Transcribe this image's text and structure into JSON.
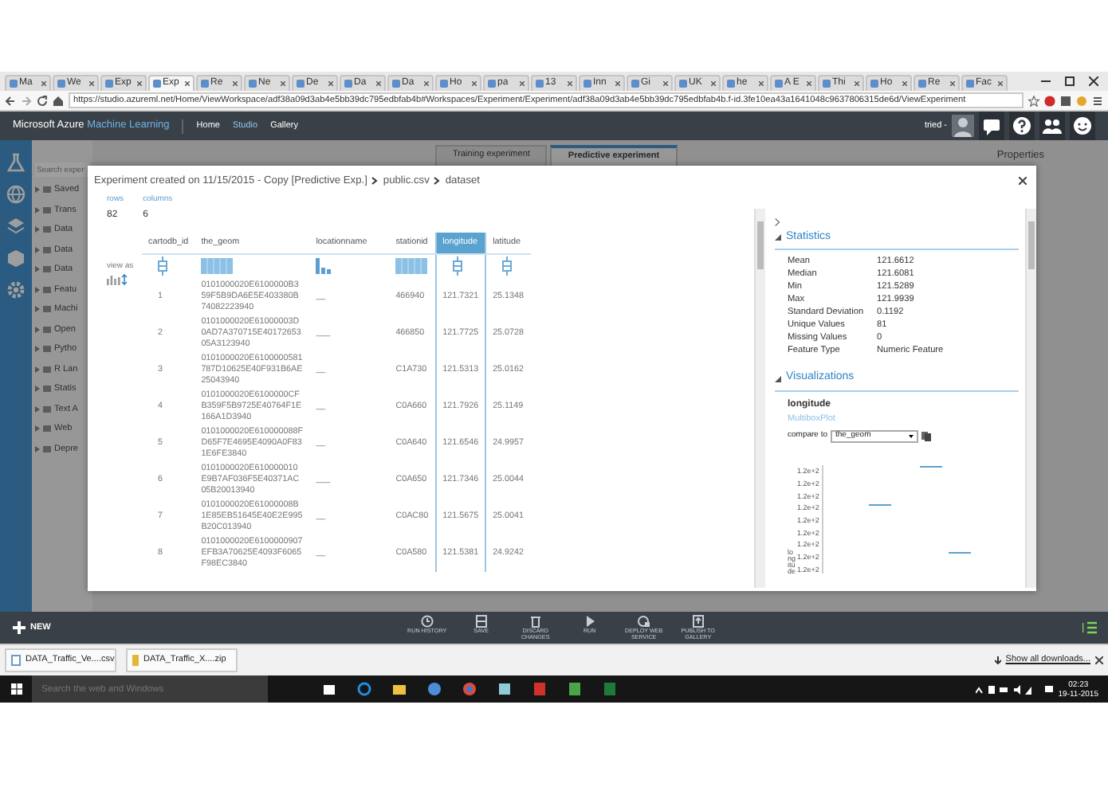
{
  "browser": {
    "tabs": [
      {
        "label": "Ma",
        "selected": false
      },
      {
        "label": "We",
        "selected": false
      },
      {
        "label": "Exp",
        "selected": false
      },
      {
        "label": "Exp",
        "selected": true
      },
      {
        "label": "Re",
        "selected": false
      },
      {
        "label": "Ne",
        "selected": false
      },
      {
        "label": "De",
        "selected": false
      },
      {
        "label": "Da",
        "selected": false
      },
      {
        "label": "Da",
        "selected": false
      },
      {
        "label": "Ho",
        "selected": false
      },
      {
        "label": "pa",
        "selected": false
      },
      {
        "label": "13",
        "selected": false
      },
      {
        "label": "Inn",
        "selected": false
      },
      {
        "label": "Gi",
        "selected": false
      },
      {
        "label": "UK",
        "selected": false
      },
      {
        "label": "he",
        "selected": false
      },
      {
        "label": "A E",
        "selected": false
      },
      {
        "label": "Thi",
        "selected": false
      },
      {
        "label": "Ho",
        "selected": false
      },
      {
        "label": "Re",
        "selected": false
      },
      {
        "label": "Fac",
        "selected": false
      }
    ],
    "url": "https://studio.azureml.net/Home/ViewWorkspace/adf38a09d3ab4e5bb39dc795edbfab4b#Workspaces/Experiment/Experiment/adf38a09d3ab4e5bb39dc795edbfab4b.f-id.3fe10ea43a1641048c9637806315de6d/ViewExperiment"
  },
  "app_header": {
    "brand": "Microsoft Azure",
    "product": "Machine Learning",
    "nav": [
      {
        "label": "Home",
        "selected": false
      },
      {
        "label": "Studio",
        "selected": true
      },
      {
        "label": "Gallery",
        "selected": false
      }
    ],
    "user": "tried -"
  },
  "workspace": {
    "experiment_tabs": [
      {
        "label": "Training experiment",
        "selected": false
      },
      {
        "label": "Predictive experiment",
        "selected": true
      }
    ],
    "search": {
      "placeholder": "Search exper"
    },
    "palette": [
      "Saved",
      "Trans",
      "Data",
      "Data",
      "Data",
      "Featu",
      "Machi",
      "Open",
      "Pytho",
      "R Lan",
      "Statis",
      "Text A",
      "Web",
      "Depre"
    ],
    "properties_title": "Properties"
  },
  "dialog": {
    "breadcrumb": [
      "Experiment created on 11/15/2015 - Copy [Predictive Exp.]",
      "public.csv",
      "dataset"
    ],
    "summary": [
      {
        "label": "rows",
        "value": "82"
      },
      {
        "label": "columns",
        "value": "6"
      }
    ],
    "view_as": "view as",
    "columns": [
      {
        "name": "cartodb_id",
        "kind": "numeric",
        "selected": false
      },
      {
        "name": "the_geom",
        "kind": "text",
        "selected": false
      },
      {
        "name": "locationname",
        "kind": "category",
        "selected": false
      },
      {
        "name": "stationid",
        "kind": "text",
        "selected": false
      },
      {
        "name": "longitude",
        "kind": "numeric",
        "selected": true
      },
      {
        "name": "latitude",
        "kind": "numeric",
        "selected": false
      }
    ],
    "rows": [
      [
        "1",
        "0101000020E6100000B359F5B9DA6E5E403380B74082223940",
        "__",
        "466940",
        "121.7321",
        "25.1348"
      ],
      [
        "2",
        "0101000020E61000003D0AD7A370715E4017265305A3123940",
        "___",
        "466850",
        "121.7725",
        "25.0728"
      ],
      [
        "3",
        "0101000020E6100000581787D10625E40F931B6AE25043940",
        "__",
        "C1A730",
        "121.5313",
        "25.0162"
      ],
      [
        "4",
        "0101000020E6100000CFB359F5B9725E40764F1E166A1D3940",
        "__",
        "C0A660",
        "121.7926",
        "25.1149"
      ],
      [
        "5",
        "0101000020E610000088FD65F7E4695E4090A0F831E6FE3840",
        "__",
        "C0A640",
        "121.6546",
        "24.9957"
      ],
      [
        "6",
        "0101000020E610000010E9B7AF036F5E40371AC05B20013940",
        "___",
        "C0A650",
        "121.7346",
        "25.0044"
      ],
      [
        "7",
        "0101000020E61000008B1E85EB51645E40E2E995B20C013940",
        "__",
        "C0AC80",
        "121.5675",
        "25.0041"
      ],
      [
        "8",
        "0101000020E6100000907EFB3A70625E4093F6065F98EC3840",
        "__",
        "C0A580",
        "121.5381",
        "24.9242"
      ]
    ],
    "statistics": {
      "title": "Statistics",
      "expanded": true,
      "items": [
        {
          "label": "Mean",
          "value": "121.6612"
        },
        {
          "label": "Median",
          "value": "121.6081"
        },
        {
          "label": "Min",
          "value": "121.5289"
        },
        {
          "label": "Max",
          "value": "121.9939"
        },
        {
          "label": "Standard Deviation",
          "value": "0.1192"
        },
        {
          "label": "Unique Values",
          "value": "81"
        },
        {
          "label": "Missing Values",
          "value": "0"
        },
        {
          "label": "Feature Type",
          "value": "Numeric Feature"
        }
      ]
    },
    "visualizations": {
      "title": "Visualizations",
      "expanded": true,
      "feature": "longitude",
      "plot_type": "MultiboxPlot",
      "compare_label": "compare to",
      "compare_value": "the_geom",
      "y_ticks": [
        "1.2e+2",
        "1.2e+2",
        "1.2e+2",
        "1.2e+2",
        "1.2e+2",
        "1.2e+2",
        "1.2e+2",
        "1.2e+2",
        "1.2e+2"
      ],
      "ylabel": "longitude"
    }
  },
  "command_bar": {
    "new": "NEW",
    "commands": [
      "RUN HISTORY",
      "SAVE",
      "DISCARD CHANGES",
      "RUN",
      "DEPLOY WEB SERVICE",
      "PUBLISH TO GALLERY"
    ]
  },
  "downloads": {
    "files": [
      {
        "name": "DATA_Traffic_Ve....csv",
        "kind": "file"
      },
      {
        "name": "DATA_Traffic_X....zip",
        "kind": "zip"
      }
    ],
    "show_all": "Show all downloads..."
  },
  "taskbar": {
    "search_placeholder": "Search the web and Windows",
    "time": "02:23",
    "date": "19-11-2015"
  }
}
